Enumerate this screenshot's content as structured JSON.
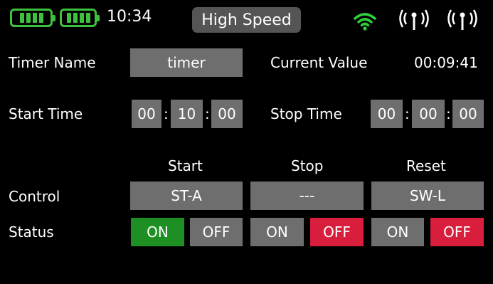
{
  "status_bar": {
    "time": "10:34",
    "mode": "High Speed",
    "battery_1_icon": "battery-icon",
    "battery_2_icon": "battery-icon",
    "wifi_icon": "wifi-icon",
    "antenna_icons": [
      "antenna-signal-icon",
      "antenna-signal-icon"
    ],
    "colors": {
      "battery": "#3ec23e",
      "wifi": "#2fd23a"
    }
  },
  "timer": {
    "name_label": "Timer Name",
    "name_value": "timer",
    "current_label": "Current Value",
    "current_value": "00:09:41"
  },
  "start_time": {
    "label": "Start Time",
    "hh": "00",
    "mm": "10",
    "ss": "00"
  },
  "stop_time": {
    "label": "Stop Time",
    "hh": "00",
    "mm": "00",
    "ss": "00"
  },
  "separator": ":",
  "columns": {
    "start": "Start",
    "stop": "Stop",
    "reset": "Reset"
  },
  "control": {
    "label": "Control",
    "start": "ST-A",
    "stop": "---",
    "reset": "SW-L"
  },
  "status": {
    "label": "Status",
    "start": {
      "on": "ON",
      "off": "OFF",
      "active": "on"
    },
    "stop": {
      "on": "ON",
      "off": "OFF",
      "active": "off"
    },
    "reset": {
      "on": "ON",
      "off": "OFF",
      "active": "off"
    },
    "colors": {
      "on_active": "#1e8f23",
      "off_active": "#d81e3c",
      "inactive": "#6e6e6e"
    }
  }
}
